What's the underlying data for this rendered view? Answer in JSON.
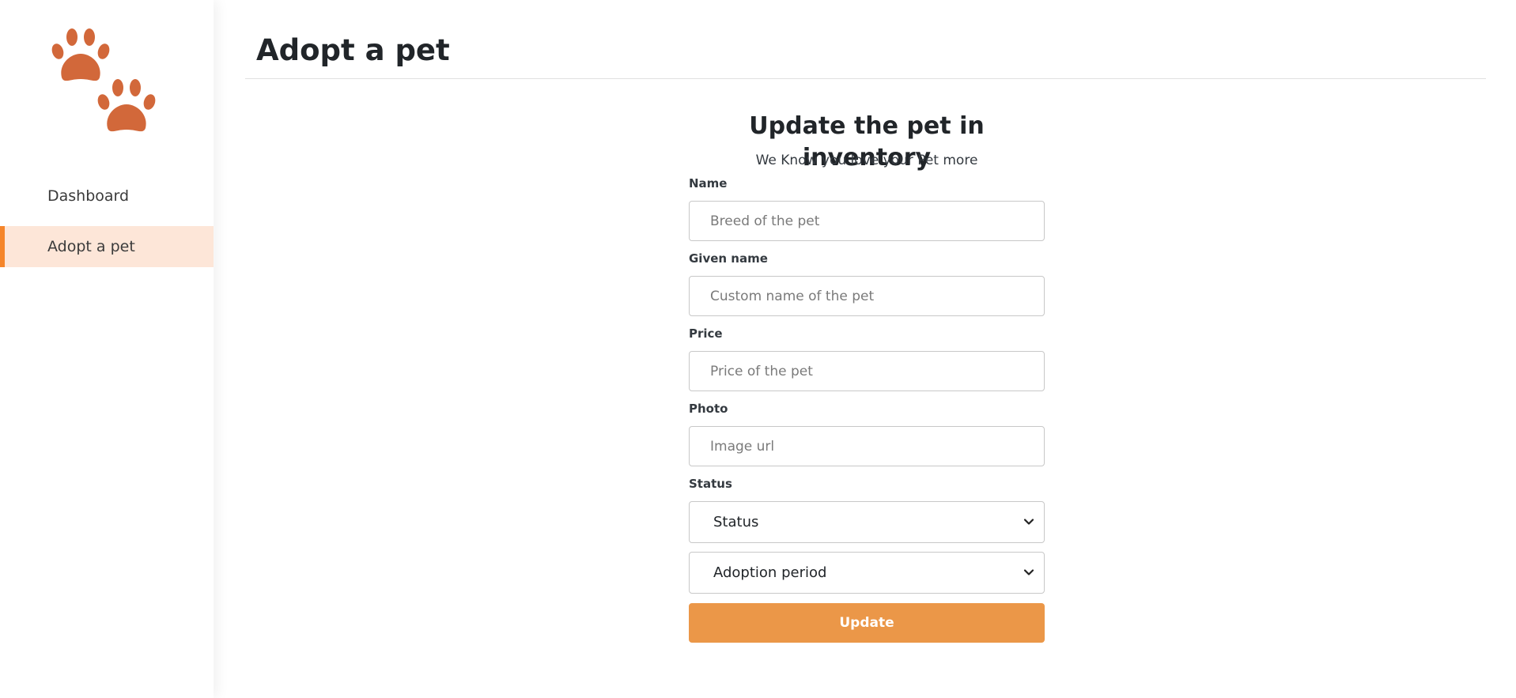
{
  "sidebar": {
    "logo_icon": "paw-prints-icon",
    "brand_color": "#d2683a",
    "items": [
      {
        "label": "Dashboard",
        "active": false
      },
      {
        "label": "Adopt a pet",
        "active": true
      }
    ],
    "active_accent": "#f5852a",
    "active_background": "#fde6d8"
  },
  "page": {
    "title": "Adopt a pet"
  },
  "form": {
    "heading": "Update the pet in inventory",
    "subheading": "We Know you love your Pet more",
    "fields": [
      {
        "label": "Name",
        "placeholder": "Breed of the pet",
        "value": ""
      },
      {
        "label": "Given name",
        "placeholder": "Custom name of the pet",
        "value": ""
      },
      {
        "label": "Price",
        "placeholder": "Price of the pet",
        "value": ""
      },
      {
        "label": "Photo",
        "placeholder": "Image url",
        "value": ""
      }
    ],
    "status_label": "Status",
    "status_select": {
      "selected": "Status",
      "icon": "chevron-down-icon"
    },
    "adoption_select": {
      "selected": "Adoption period",
      "icon": "chevron-down-icon"
    },
    "submit_label": "Update",
    "submit_color": "#eb9748"
  }
}
